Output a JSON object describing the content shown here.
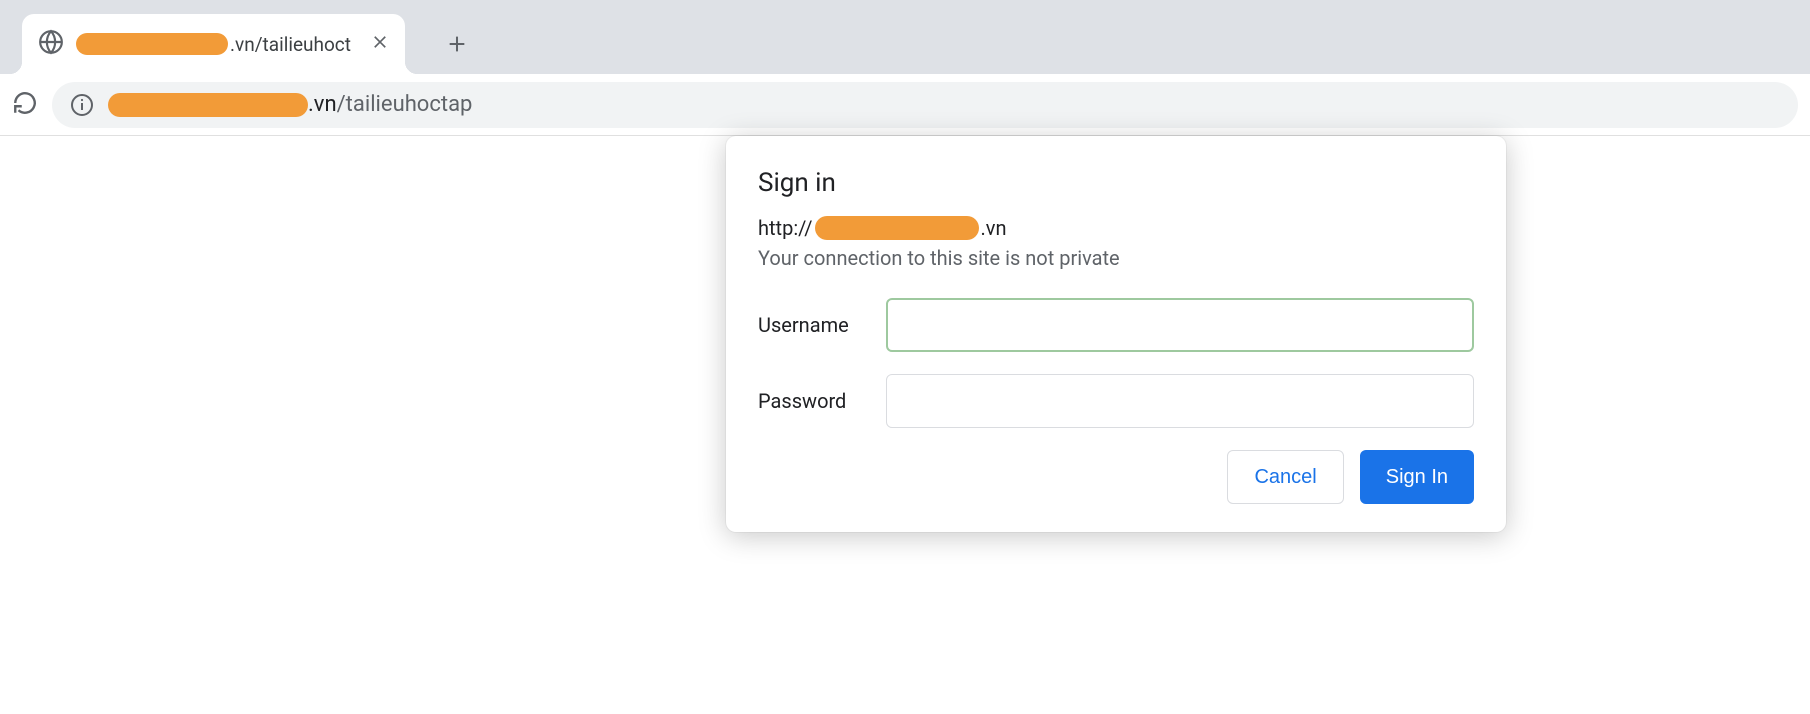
{
  "tab": {
    "title_suffix": ".vn/tailieuhoct"
  },
  "address": {
    "domain_suffix": ".vn",
    "path": "/tailieuhoctap"
  },
  "dialog": {
    "title": "Sign in",
    "origin_prefix": "http://",
    "origin_suffix": ".vn",
    "warning": "Your connection to this site is not private",
    "username_label": "Username",
    "password_label": "Password",
    "cancel_label": "Cancel",
    "signin_label": "Sign In"
  }
}
